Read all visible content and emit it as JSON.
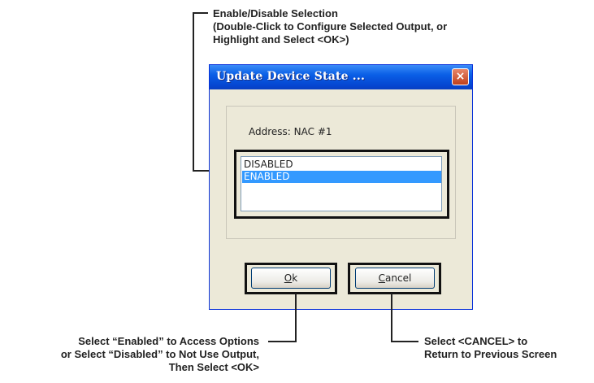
{
  "window": {
    "title": "Update Device State ...",
    "close_glyph": "×"
  },
  "dialog": {
    "address_label": "Address: NAC #1",
    "list_items": [
      "DISABLED",
      "ENABLED"
    ],
    "selected_item": "ENABLED",
    "ok_button": {
      "key": "O",
      "rest": "k"
    },
    "cancel_button": {
      "key": "C",
      "rest": "ancel"
    }
  },
  "callouts": {
    "top": [
      "Enable/Disable Selection",
      "(Double-Click to Configure Selected Output, or",
      "Highlight and Select <OK>)"
    ],
    "bottom_left": [
      "Select “Enabled” to Access Options",
      "or Select “Disabled” to Not Use Output,",
      "Then Select <OK>"
    ],
    "bottom_right": [
      "Select <CANCEL> to",
      "Return to Previous Screen"
    ]
  },
  "colors": {
    "titlebar": "#0a5fe6",
    "selection": "#3399ff",
    "dialog_bg": "#ece9d8"
  }
}
